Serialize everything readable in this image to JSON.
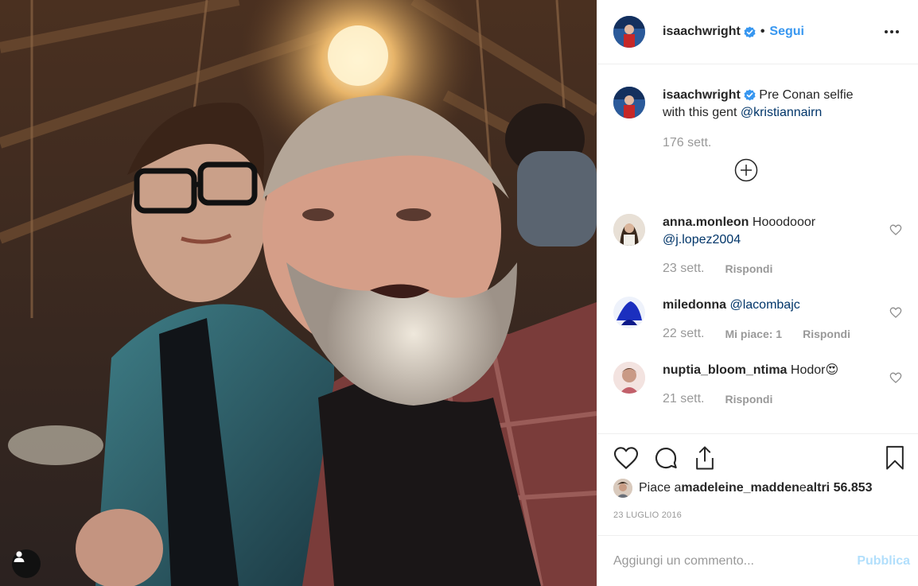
{
  "post": {
    "author": "isaachwright",
    "follow_label": "Segui",
    "separator": "•",
    "more_icon": "more-horizontal-icon",
    "verified_color": "#3897f0"
  },
  "caption": {
    "username": "isaachwright",
    "text": "Pre Conan selfie with this gent ",
    "mention": "@kristiannairn",
    "time": "176 sett."
  },
  "comments": [
    {
      "username": "anna.monleon",
      "text": "Hooodooor ",
      "mention": "@j.lopez2004",
      "time": "23 sett.",
      "likes": "",
      "reply": "Rispondi"
    },
    {
      "username": "miledonna",
      "text": "",
      "mention": "@lacombajc",
      "time": "22 sett.",
      "likes": "Mi piace: 1",
      "reply": "Rispondi"
    },
    {
      "username": "nuptia_bloom_ntima",
      "text": "Hodor",
      "emoji": "😍",
      "mention": "",
      "time": "21 sett.",
      "likes": "",
      "reply": "Rispondi"
    }
  ],
  "likes": {
    "prefix": "Piace a ",
    "user": "madeleine_madden",
    "middle": " e ",
    "others": "altri 56.853"
  },
  "date": "23 LUGLIO 2016",
  "add_comment": {
    "placeholder": "Aggiungi un commento...",
    "publish": "Pubblica"
  },
  "colors": {
    "accent": "#3897f0",
    "mention": "#003569",
    "muted": "#999999",
    "publish_disabled": "#b2dffc"
  }
}
